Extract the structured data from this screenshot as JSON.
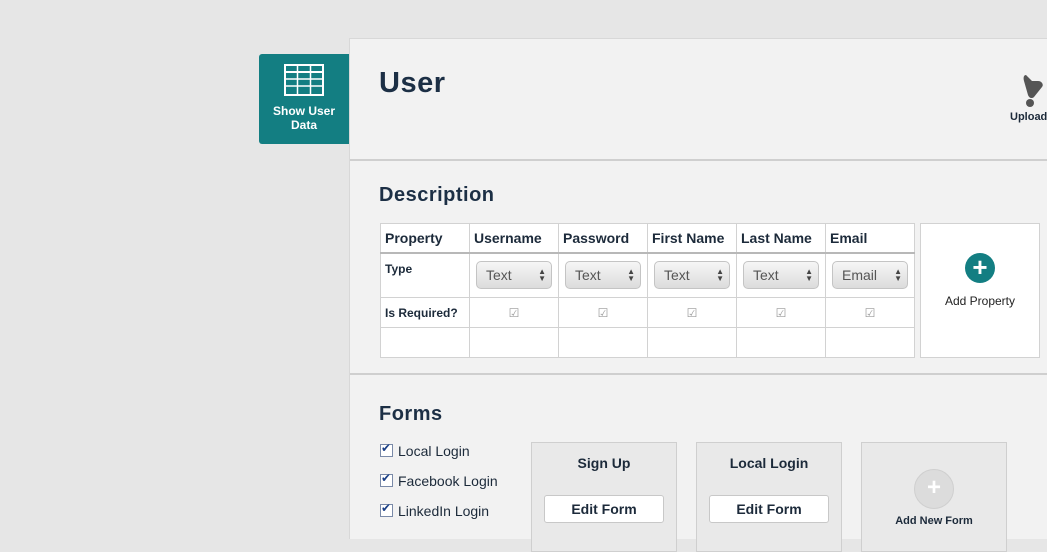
{
  "sidebar": {
    "show_user_data": "Show User Data"
  },
  "header": {
    "title": "User",
    "upload_label": "Upload"
  },
  "description": {
    "title": "Description",
    "property_header": "Property",
    "type_label": "Type",
    "required_label": "Is Required?",
    "add_property_label": "Add Property",
    "columns": [
      {
        "name": "Username",
        "type": "Text",
        "required": true
      },
      {
        "name": "Password",
        "type": "Text",
        "required": true
      },
      {
        "name": "First Name",
        "type": "Text",
        "required": true
      },
      {
        "name": "Last Name",
        "type": "Text",
        "required": true
      },
      {
        "name": "Email",
        "type": "Email",
        "required": true
      }
    ]
  },
  "forms": {
    "title": "Forms",
    "login_options": [
      {
        "label": "Local Login",
        "checked": true
      },
      {
        "label": "Facebook Login",
        "checked": true
      },
      {
        "label": "LinkedIn Login",
        "checked": true
      }
    ],
    "cards": [
      {
        "title": "Sign Up",
        "button": "Edit Form"
      },
      {
        "title": "Local Login",
        "button": "Edit Form"
      }
    ],
    "add_new_form": "Add New Form"
  },
  "colors": {
    "accent": "#137e82",
    "title": "#1c2f45"
  }
}
